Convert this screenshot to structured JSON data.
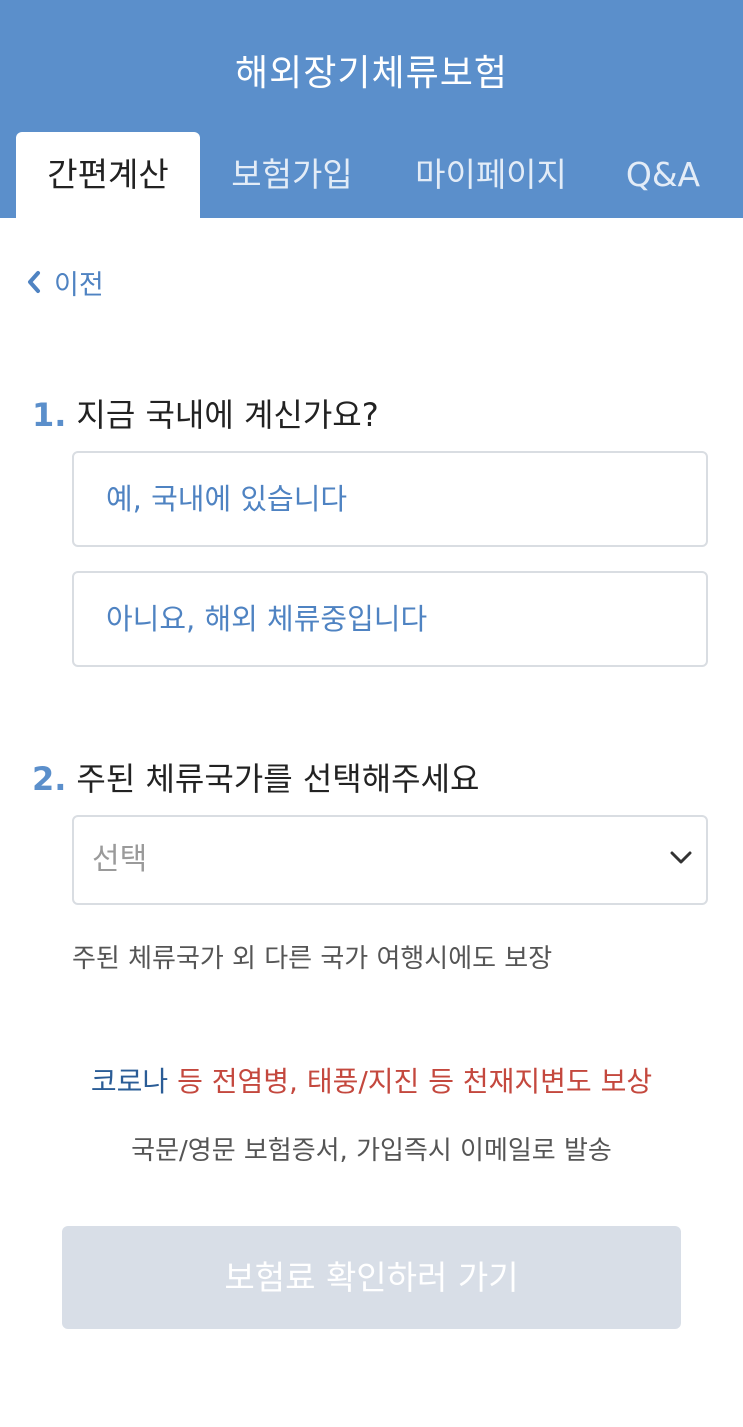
{
  "header": {
    "title": "해외장기체류보험",
    "tabs": [
      {
        "label": "간편계산",
        "active": true
      },
      {
        "label": "보험가입",
        "active": false
      },
      {
        "label": "마이페이지",
        "active": false
      },
      {
        "label": "Q&A",
        "active": false
      }
    ]
  },
  "back": {
    "label": "이전",
    "icon": "chevron-left-icon"
  },
  "q1": {
    "number": "1.",
    "text": "지금 국내에 계신가요?",
    "options": [
      "예, 국내에 있습니다",
      "아니요, 해외 체류중입니다"
    ]
  },
  "q2": {
    "number": "2.",
    "text": "주된 체류국가를 선택해주세요",
    "select_value": "선택",
    "note": "주된 체류국가 외 다른 국가 여행시에도 보장"
  },
  "promo": {
    "blue_text": "코로나",
    "red_text": " 등 전염병, 태풍/지진 등 천재지변도 보상",
    "sub_text": "국문/영문 보험증서, 가입즉시 이메일로 발송"
  },
  "cta": {
    "label": "보험료 확인하러 가기",
    "enabled": false
  },
  "colors": {
    "header_bg": "#5b8fcb",
    "accent": "#4f83c2",
    "promo_blue": "#2a5c96",
    "promo_red": "#c4483e",
    "cta_disabled": "#d8dee7"
  }
}
